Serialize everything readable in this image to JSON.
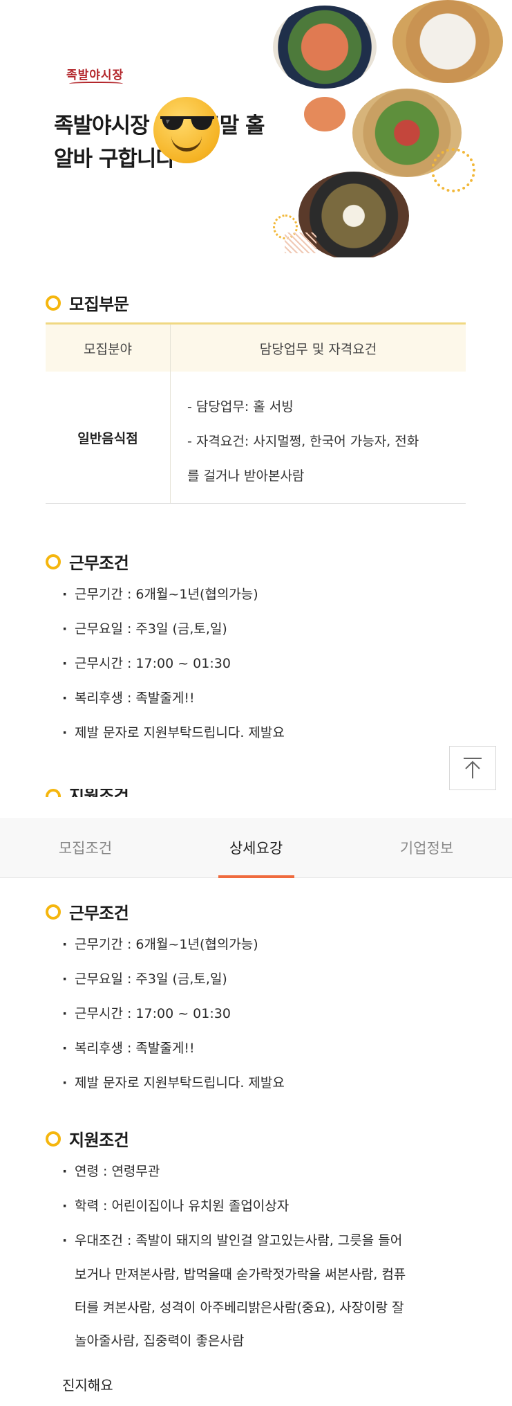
{
  "hero": {
    "logo_text": "족발야시장",
    "title_line1": "족발야시장 에서 주말 홀",
    "title_line2": "알바 구합니다"
  },
  "recruit": {
    "heading": "모집부문",
    "col1_header": "모집분야",
    "col2_header": "담당업무 및 자격요건",
    "field": "일반음식점",
    "duty": "- 담당업무: 홀 서빙",
    "requirement_a": "- 자격요건: 사지멀쩡, 한국어 가능자, 전화",
    "requirement_b": "를 걸거나 받아본사람"
  },
  "work": {
    "heading": "근무조건",
    "items": [
      "근무기간 : 6개월~1년(협의가능)",
      "근무요일 : 주3일 (금,토,일)",
      "근무시간 : 17:00 ~ 01:30",
      "복리후생 : 족발줄게!!",
      "제발 문자로 지원부탁드립니다. 제발요"
    ]
  },
  "cut_heading": "지원조건",
  "tabs": [
    "모집조건",
    "상세요강",
    "기업정보"
  ],
  "apply": {
    "heading": "지원조건",
    "items": [
      "연령 : 연령무관",
      "학력 : 어린이집이나 유치원 졸업이상자",
      "우대조건 : 족발이 돼지의 발인걸 알고있는사람, 그릇을 들어"
    ],
    "continuation": [
      "보거나 만져본사람, 밥먹을때 숟가락젓가락을 써본사람, 컴퓨",
      "터를 켜본사람, 성격이 아주베리밝은사람(중요), 사장이랑 잘",
      "놀아줄사람, 집중력이 좋은사람"
    ],
    "closing": "진지해요"
  },
  "colors": {
    "accent_yellow": "#f5b60e",
    "tab_active": "#ef6b3e"
  },
  "icons": {
    "scroll_top": "arrow-up-icon",
    "emoji": "sunglasses-emoji-icon"
  }
}
